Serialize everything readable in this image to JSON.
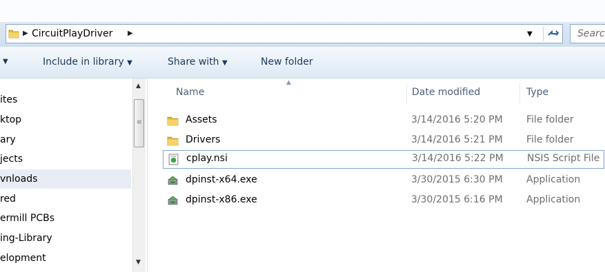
{
  "address": {
    "crumbs": [
      "CircuitPlayDriver"
    ],
    "search_placeholder": "Search"
  },
  "toolbar": {
    "include_in_library": "Include in library",
    "share_with": "Share with",
    "new_folder": "New folder"
  },
  "nav": {
    "items": [
      {
        "label": "ites"
      },
      {
        "label": "ktop"
      },
      {
        "label": "ary"
      },
      {
        "label": "jects"
      },
      {
        "label": "vnloads",
        "selected": true
      },
      {
        "label": "red"
      },
      {
        "label": "ermill PCBs"
      },
      {
        "label": "ing-Library"
      },
      {
        "label": "elopment"
      }
    ]
  },
  "columns": {
    "name": "Name",
    "date_modified": "Date modified",
    "type": "Type"
  },
  "files": [
    {
      "name": "Assets",
      "date": "3/14/2016 5:20 PM",
      "type": "File folder",
      "icon": "folder-icon"
    },
    {
      "name": "Drivers",
      "date": "3/14/2016 5:21 PM",
      "type": "File folder",
      "icon": "folder-icon"
    },
    {
      "name": "cplay.nsi",
      "date": "3/14/2016 5:22 PM",
      "type": "NSIS Script File",
      "icon": "nsis-script-icon",
      "selected": true
    },
    {
      "name": "dpinst-x64.exe",
      "date": "3/30/2015 6:30 PM",
      "type": "Application",
      "icon": "installer-app-icon"
    },
    {
      "name": "dpinst-x86.exe",
      "date": "3/30/2015 6:16 PM",
      "type": "Application",
      "icon": "installer-app-icon"
    }
  ]
}
